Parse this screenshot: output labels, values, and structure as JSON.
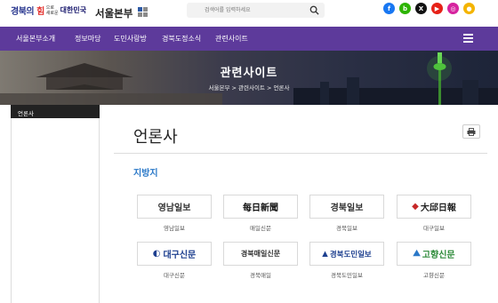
{
  "header": {
    "logo_mark": "경북의 힘",
    "logo_small_line1": "으로",
    "logo_small_line2": "새로운",
    "logo_nation": "대한민국",
    "title": "서울본부",
    "brand_square_colors": [
      "#2d5aa6",
      "#8a8a8a",
      "#8a8a8a",
      "#8a8a8a"
    ]
  },
  "search": {
    "placeholder": "검색어를 입력하세요"
  },
  "social": [
    {
      "icon": "facebook-icon",
      "glyph": "f",
      "color": "#1877f2"
    },
    {
      "icon": "blog-icon",
      "glyph": "b",
      "color": "#2db400"
    },
    {
      "icon": "x-icon",
      "glyph": "X",
      "color": "#111111"
    },
    {
      "icon": "youtube-icon",
      "glyph": "▶",
      "color": "#e62117"
    },
    {
      "icon": "instagram-icon",
      "glyph": "◎",
      "color": "#d6249f"
    },
    {
      "icon": "kakao-icon",
      "glyph": "●",
      "color": "#f4b400"
    }
  ],
  "nav": {
    "items": [
      "서울본부소개",
      "정보마당",
      "도민사랑방",
      "경북도정소식",
      "관련사이트"
    ],
    "bg_color": "#5d3a9b"
  },
  "banner": {
    "title": "관련사이트",
    "breadcrumb": "서울본부 > 관련사이트 > 언론사"
  },
  "sidebar": {
    "heading": "언론사"
  },
  "content": {
    "title": "언론사",
    "print_icon": "print-icon",
    "section_title": "지방지",
    "accent_color": "#2a78c8",
    "newspapers": [
      {
        "logo_text": "영남일보",
        "caption": "영남일보",
        "logo_color": "#333333"
      },
      {
        "logo_text": "每日新聞",
        "caption": "매일신문",
        "logo_color": "#111111"
      },
      {
        "logo_text": "경북일보",
        "caption": "경북일보",
        "logo_color": "#333333"
      },
      {
        "logo_text": "大邱日報",
        "caption": "대구일보",
        "logo_color": "#222222"
      },
      {
        "logo_text": "대구신문",
        "caption": "대구신문",
        "logo_color": "#1d3f8f"
      },
      {
        "logo_text": "경북매일신문",
        "caption": "경북매일",
        "logo_color": "#333333"
      },
      {
        "logo_text": "경북도민일보",
        "caption": "경북도민일보",
        "logo_color": "#1d3f8f"
      },
      {
        "logo_text": "고향신문",
        "caption": "고향신문",
        "logo_color": "#2e8b3a"
      }
    ]
  }
}
